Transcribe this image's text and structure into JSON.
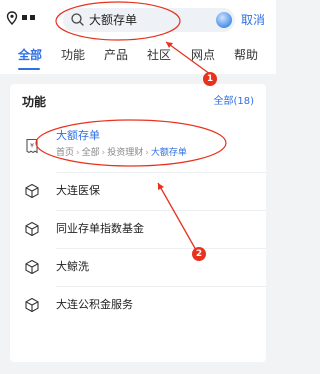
{
  "header": {
    "search_query": "大额存单",
    "cancel_label": "取消"
  },
  "tabs": [
    {
      "label": "全部",
      "active": true
    },
    {
      "label": "功能",
      "active": false
    },
    {
      "label": "产品",
      "active": false
    },
    {
      "label": "社区",
      "active": false
    },
    {
      "label": "网点",
      "active": false
    },
    {
      "label": "帮助",
      "active": false
    }
  ],
  "section": {
    "title": "功能",
    "all_label": "全部(18)"
  },
  "results": [
    {
      "label": "大额存单",
      "icon": "receipt-icon",
      "breadcrumb": [
        "首页",
        "全部",
        "投资理财",
        "大额存单"
      ]
    },
    {
      "label": "大连医保",
      "icon": "cube-icon"
    },
    {
      "label": "同业存单指数基金",
      "icon": "cube-icon"
    },
    {
      "label": "大鲸洗",
      "icon": "cube-icon"
    },
    {
      "label": "大连公积金服务",
      "icon": "cube-icon"
    }
  ],
  "annotations": [
    "1",
    "2"
  ],
  "colors": {
    "accent": "#2f6fe4",
    "annotation": "#e8321e"
  }
}
